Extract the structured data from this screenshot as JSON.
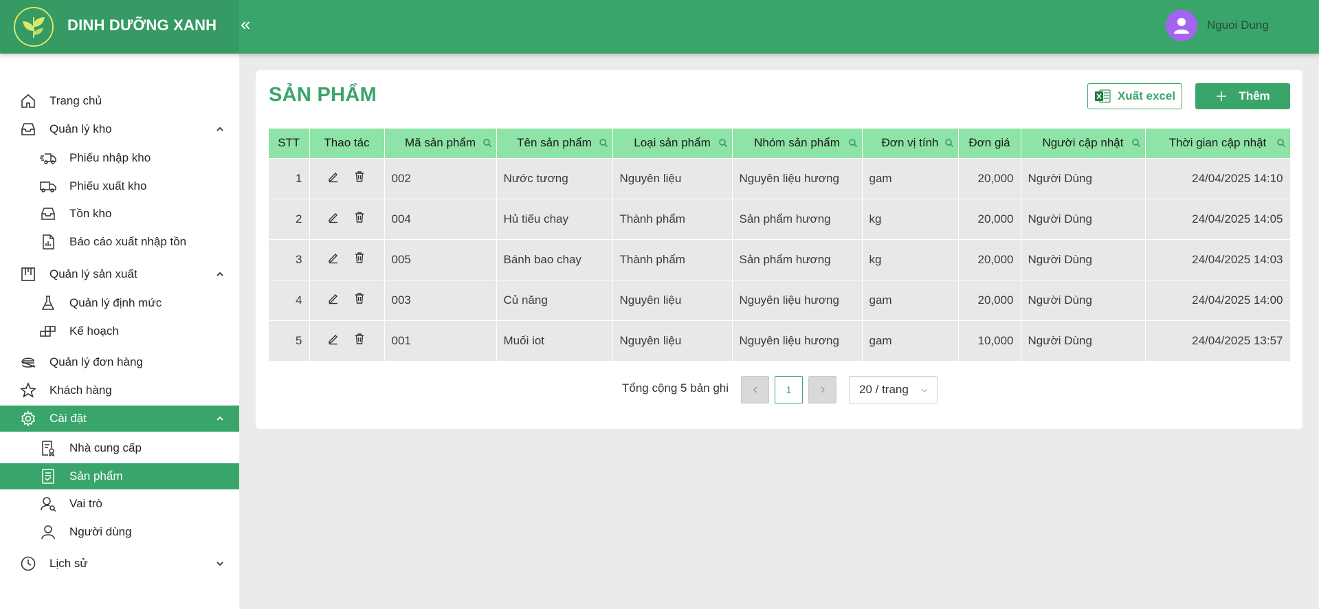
{
  "header": {
    "brand": "DINH DƯỠNG XANH",
    "collapse_icon": "«",
    "user_name": "Nguoi Dung"
  },
  "sidebar": {
    "items": [
      {
        "label": "Trang chủ",
        "icon": "home-icon"
      },
      {
        "label": "Quản lý kho",
        "icon": "inbox-icon",
        "expanded": true
      },
      {
        "label": "Phiếu nhập kho",
        "icon": "truck-icon"
      },
      {
        "label": "Phiếu xuất kho",
        "icon": "truck-out-icon"
      },
      {
        "label": "Tồn kho",
        "icon": "inbox-icon"
      },
      {
        "label": "Báo cáo xuất nhập tồn",
        "icon": "report-icon"
      },
      {
        "label": "Quản lý sản xuất",
        "icon": "factory-icon",
        "expanded": true
      },
      {
        "label": "Quản lý định mức",
        "icon": "flask-icon"
      },
      {
        "label": "Kế hoạch",
        "icon": "blocks-icon"
      },
      {
        "label": "Quản lý đơn hàng",
        "icon": "orders-icon"
      },
      {
        "label": "Khách hàng",
        "icon": "star-icon"
      },
      {
        "label": "Cài đặt",
        "icon": "gear-icon",
        "expanded": true,
        "active": true
      },
      {
        "label": "Nhà cung cấp",
        "icon": "supplier-icon"
      },
      {
        "label": "Sản phẩm",
        "icon": "product-icon",
        "active": true
      },
      {
        "label": "Vai trò",
        "icon": "role-icon"
      },
      {
        "label": "Người dùng",
        "icon": "user-icon"
      },
      {
        "label": "Lịch sử",
        "icon": "history-icon",
        "expanded": false
      }
    ]
  },
  "page": {
    "title": "SẢN PHẨM",
    "export_label": "Xuất excel",
    "add_label": "Thêm"
  },
  "table": {
    "columns": [
      "STT",
      "Thao tác",
      "Mã sản phẩm",
      "Tên sản phẩm",
      "Loại sản phẩm",
      "Nhóm sản phẩm",
      "Đơn vị tính",
      "Đơn giá",
      "Người cập nhật",
      "Thời gian cập nhật"
    ],
    "rows": [
      {
        "stt": "1",
        "code": "002",
        "name": "Nước tương",
        "type": "Nguyên liệu",
        "group": "Nguyên liệu hương",
        "unit": "gam",
        "price": "20,000",
        "updated_by": "Người Dùng",
        "updated_at": "24/04/2025 14:10"
      },
      {
        "stt": "2",
        "code": "004",
        "name": "Hủ tiếu chay",
        "type": "Thành phẩm",
        "group": "Sản phẩm hương",
        "unit": "kg",
        "price": "20,000",
        "updated_by": "Người Dùng",
        "updated_at": "24/04/2025 14:05"
      },
      {
        "stt": "3",
        "code": "005",
        "name": "Bánh bao chay",
        "type": "Thành phẩm",
        "group": "Sản phẩm hương",
        "unit": "kg",
        "price": "20,000",
        "updated_by": "Người Dùng",
        "updated_at": "24/04/2025 14:03"
      },
      {
        "stt": "4",
        "code": "003",
        "name": "Củ năng",
        "type": "Nguyên liệu",
        "group": "Nguyên liệu hương",
        "unit": "gam",
        "price": "20,000",
        "updated_by": "Người Dùng",
        "updated_at": "24/04/2025 14:00"
      },
      {
        "stt": "5",
        "code": "001",
        "name": "Muối iot",
        "type": "Nguyên liệu",
        "group": "Nguyên liệu hương",
        "unit": "gam",
        "price": "10,000",
        "updated_by": "Người Dùng",
        "updated_at": "24/04/2025 13:57"
      }
    ]
  },
  "pagination": {
    "total": "Tổng cộng 5 bản ghi",
    "current_page": "1",
    "page_size": "20 / trang"
  },
  "colors": {
    "primary": "#3aa56b",
    "header_row": "#8ee3a6",
    "row_bg": "#e8e8eb",
    "avatar": "#a364f2"
  }
}
